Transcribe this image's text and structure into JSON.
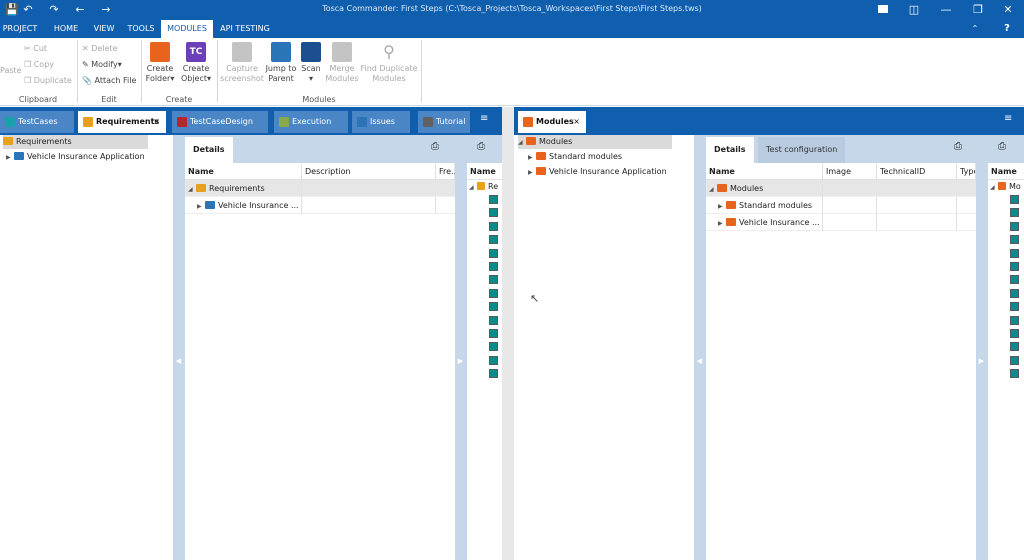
{
  "app": {
    "title": "Tosca Commander: First Steps (C:\\Tosca_Projects\\Tosca_Workspaces\\First Steps\\First Steps.tws)"
  },
  "menu": [
    "PROJECT",
    "HOME",
    "VIEW",
    "TOOLS",
    "MODULES",
    "API TESTING"
  ],
  "ribbon": {
    "clipboard": {
      "paste": "Paste",
      "cut": "Cut",
      "copy": "Copy",
      "duplicate": "Duplicate",
      "group": "Clipboard"
    },
    "edit": {
      "delete": "Delete",
      "modify": "Modify",
      "attach": "Attach File",
      "group": "Edit"
    },
    "create": {
      "folder": [
        "Create",
        "Folder"
      ],
      "object": [
        "Create",
        "Object"
      ],
      "group": "Create"
    },
    "modules": {
      "capture": [
        "Capture",
        "screenshot"
      ],
      "jump": [
        "Jump to",
        "Parent"
      ],
      "scan": "Scan",
      "merge": [
        "Merge",
        "Modules"
      ],
      "find": [
        "Find Duplicate",
        "Modules"
      ],
      "group": "Modules"
    }
  },
  "tabs_left": [
    {
      "label": "TestCases",
      "color": "#19a0a8"
    },
    {
      "label": "Requirements",
      "color": "#e8a11c"
    },
    {
      "label": "TestCaseDesign",
      "color": "#b5262f"
    },
    {
      "label": "Execution",
      "color": "#88a84a"
    },
    {
      "label": "Issues",
      "color": "#2c74b8"
    },
    {
      "label": "Tutorial",
      "color": "#616161"
    }
  ],
  "tab_right": {
    "label": "Modules",
    "color": "#e8641c"
  },
  "left_tree": {
    "root": "Requirements",
    "child": "Vehicle Insurance Application"
  },
  "left_details": {
    "tab": "Details",
    "columns": [
      "Name",
      "Description",
      "Fre..."
    ],
    "rows": [
      "Requirements",
      "Vehicle Insurance ..."
    ]
  },
  "left_mini": {
    "col": "Name",
    "row": "Re"
  },
  "right_tree": {
    "root": "Modules",
    "children": [
      "Standard modules",
      "Vehicle Insurance Application"
    ]
  },
  "right_details": {
    "tabs": [
      "Details",
      "Test configuration"
    ],
    "columns": [
      "Name",
      "Image",
      "TechnicalID",
      "Type"
    ],
    "rows": [
      "Modules",
      "Standard modules",
      "Vehicle Insurance ..."
    ]
  },
  "right_mini": {
    "col": "Name",
    "row": "Mo"
  }
}
